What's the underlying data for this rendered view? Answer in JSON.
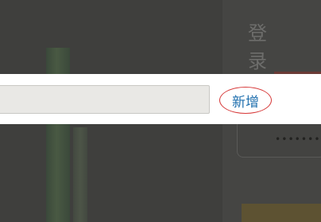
{
  "login": {
    "title": "登 录",
    "password_mask": "••••••••"
  },
  "toolbar": {
    "input_value": "",
    "add_label": "新增"
  },
  "colors": {
    "overlay": "#3f3f3d",
    "link": "#1f6fae",
    "annotation_circle": "#d73a3a"
  }
}
